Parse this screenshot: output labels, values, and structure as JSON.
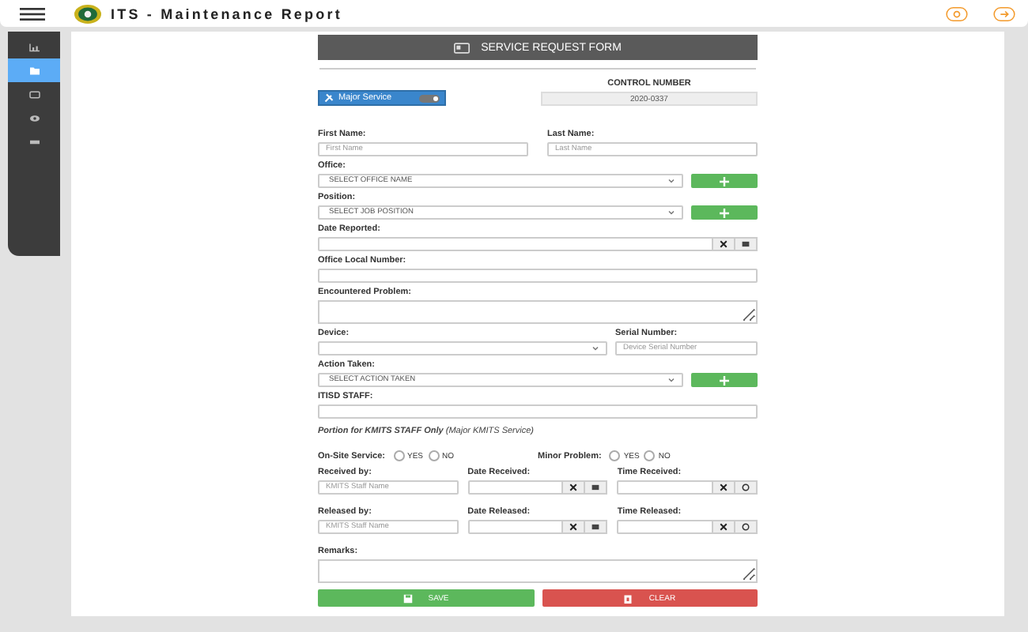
{
  "app_bar": {
    "title": "ITS - Maintenance Report"
  },
  "sidebar": {
    "items": [
      {
        "kind": "chart",
        "selected": false
      },
      {
        "kind": "folder",
        "selected": true
      },
      {
        "kind": "card",
        "selected": false
      },
      {
        "kind": "eye",
        "selected": false
      },
      {
        "kind": "bar",
        "selected": false
      }
    ]
  },
  "form": {
    "title": "SERVICE REQUEST FORM",
    "service_toggle": {
      "label": "Major Service",
      "on": true
    },
    "control_number": {
      "label": "CONTROL NUMBER",
      "value": "2020-0337"
    },
    "rows": [
      {
        "kind": "pair",
        "items": [
          {
            "kind": "text",
            "label": "First Name:",
            "placeholder": "First Name"
          },
          {
            "kind": "text",
            "label": "Last Name:",
            "placeholder": "Last Name"
          }
        ]
      },
      {
        "kind": "single",
        "items": [
          {
            "kind": "select_add",
            "label": "Office:",
            "value": "SELECT OFFICE NAME"
          }
        ]
      },
      {
        "kind": "single",
        "items": [
          {
            "kind": "select_add",
            "label": "Position:",
            "value": "SELECT JOB POSITION"
          }
        ]
      },
      {
        "kind": "single",
        "items": [
          {
            "kind": "date",
            "label": "Date Reported:"
          }
        ]
      },
      {
        "kind": "single",
        "items": [
          {
            "kind": "text",
            "label": "Office Local Number:"
          }
        ]
      },
      {
        "kind": "single",
        "items": [
          {
            "kind": "textarea",
            "label": "Encountered Problem:"
          }
        ]
      },
      {
        "kind": "wide_narrow",
        "items": [
          {
            "kind": "select",
            "label": "Device:"
          },
          {
            "kind": "text",
            "label": "Serial Number:",
            "placeholder": "Device Serial Number"
          }
        ]
      },
      {
        "kind": "single",
        "items": [
          {
            "kind": "select_add",
            "label": "Action Taken:",
            "value": "SELECT ACTION TAKEN"
          }
        ]
      },
      {
        "kind": "single",
        "items": [
          {
            "kind": "text",
            "label": "ITISD STAFF:"
          }
        ]
      },
      {
        "kind": "note",
        "text": "**Portion for KMITS STAFF Only** (Major KMITS Service)"
      },
      {
        "kind": "radios",
        "groups": [
          {
            "label": "On-Site Service:",
            "options": [
              {
                "label": "YES",
                "selected": false
              },
              {
                "label": "NO",
                "selected": false
              }
            ]
          },
          {
            "label": "Minor Problem:",
            "options": [
              {
                "label": "YES",
                "selected": false
              },
              {
                "label": "NO",
                "selected": false
              }
            ]
          }
        ]
      },
      {
        "kind": "triple",
        "items": [
          {
            "kind": "text",
            "label": "Received by:",
            "placeholder": "KMITS Staff Name"
          },
          {
            "kind": "date",
            "label": "Date Received:"
          },
          {
            "kind": "time",
            "label": "Time Received:"
          }
        ]
      },
      {
        "kind": "triple",
        "items": [
          {
            "kind": "text",
            "label": "Released by:",
            "placeholder": "KMITS Staff Name"
          },
          {
            "kind": "date",
            "label": "Date Released:"
          },
          {
            "kind": "time",
            "label": "Time Released:"
          }
        ]
      },
      {
        "kind": "single",
        "items": [
          {
            "kind": "textarea",
            "label": "Remarks:"
          }
        ]
      }
    ],
    "actions": [
      {
        "kind": "save",
        "label": "SAVE"
      },
      {
        "kind": "clear",
        "label": "CLEAR"
      }
    ]
  }
}
